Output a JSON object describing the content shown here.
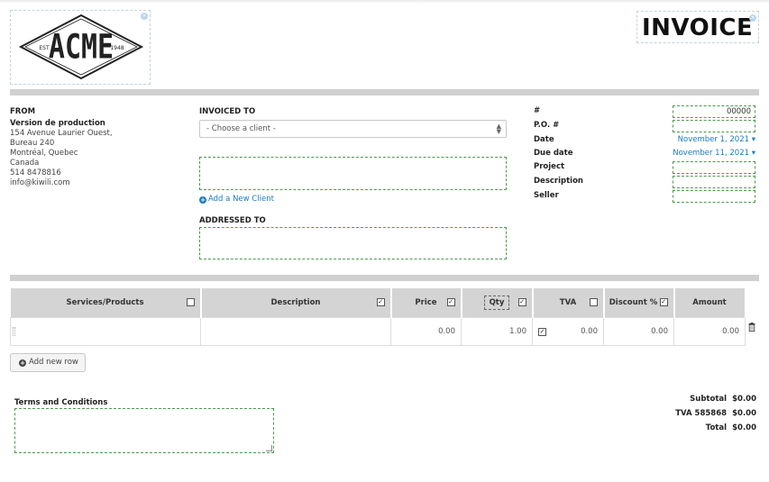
{
  "logo": {
    "brand": "ACME",
    "est_left": "EST",
    "est_right": "1948",
    "remove_icon": "close-icon"
  },
  "document_title": "INVOICE",
  "from": {
    "heading": "FROM",
    "company": "Version de production",
    "address_line1": "154 Avenue Laurier Ouest,",
    "address_line2": "Bureau 240",
    "city": "Montréal, Quebec",
    "country": "Canada",
    "phone": "514 8478816",
    "email": "info@kiwili.com"
  },
  "invoiced_to": {
    "heading": "INVOICED TO",
    "select_placeholder": "- Choose a client -",
    "add_client_label": "Add a New Client"
  },
  "addressed_to": {
    "heading": "ADDRESSED TO"
  },
  "meta": {
    "number_label": "#",
    "number_value": "00000",
    "po_label": "P.O. #",
    "date_label": "Date",
    "date_value": "November 1, 2021",
    "due_date_label": "Due date",
    "due_date_value": "November 11, 2021",
    "project_label": "Project",
    "description_label": "Description",
    "seller_label": "Seller",
    "dropdown_icon": "caret-down-icon"
  },
  "table": {
    "columns": [
      {
        "label": "Services/Products",
        "checked": false
      },
      {
        "label": "Description",
        "checked": true
      },
      {
        "label": "Price",
        "checked": true
      },
      {
        "label": "Qty",
        "checked": true
      },
      {
        "label": "TVA",
        "checked": false
      },
      {
        "label": "Discount %",
        "checked": true
      },
      {
        "label": "Amount"
      }
    ],
    "row": {
      "price": "0.00",
      "qty": "1.00",
      "tva_checked": true,
      "tva": "0.00",
      "discount": "0.00",
      "amount": "0.00"
    },
    "add_row_label": "Add new row"
  },
  "terms": {
    "heading": "Terms and Conditions"
  },
  "totals": {
    "subtotal_label": "Subtotal",
    "subtotal_value": "$0.00",
    "tax_label": "TVA 585868",
    "tax_value": "$0.00",
    "total_label": "Total",
    "total_value": "$0.00"
  },
  "colors": {
    "accent": "#1a7bbf",
    "field_border": "#4d9a4d",
    "band": "#d0d0d0",
    "header_bg": "#d4d4d4"
  }
}
